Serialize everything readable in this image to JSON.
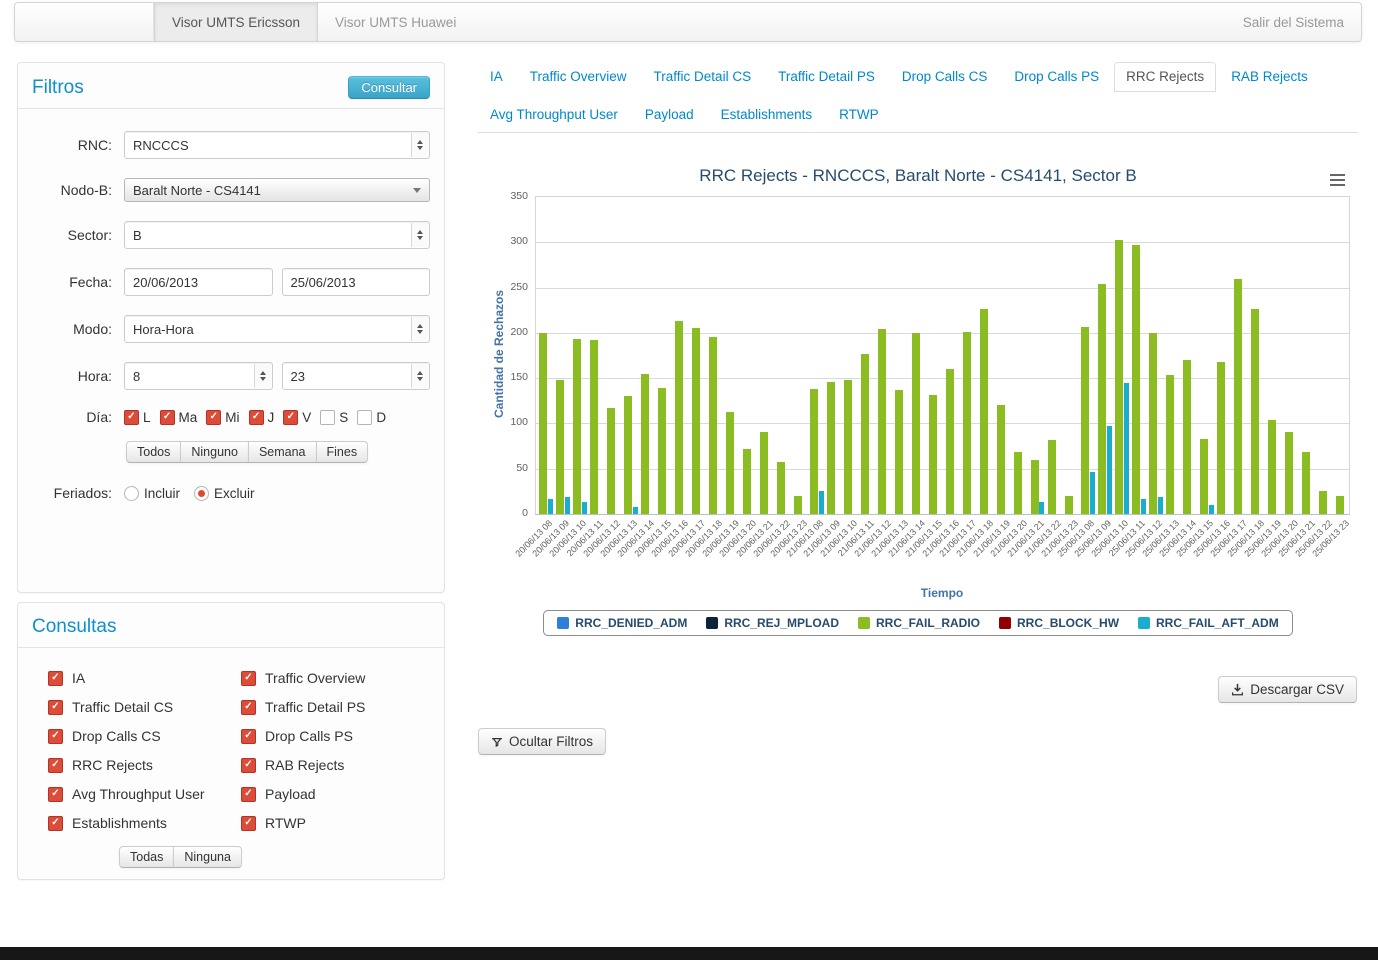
{
  "navbar": {
    "tab_ericsson": "Visor UMTS Ericsson",
    "tab_huawei": "Visor UMTS Huawei",
    "logout": "Salir del Sistema"
  },
  "filtros": {
    "title": "Filtros",
    "consultar_button": "Consultar",
    "fields": {
      "rnc": {
        "label": "RNC:",
        "value": "RNCCCS"
      },
      "nodob": {
        "label": "Nodo-B:",
        "value": "Baralt Norte - CS4141"
      },
      "sector": {
        "label": "Sector:",
        "value": "B"
      },
      "fecha": {
        "label": "Fecha:",
        "from": "20/06/2013",
        "to": "25/06/2013"
      },
      "modo": {
        "label": "Modo:",
        "value": "Hora-Hora"
      },
      "hora": {
        "label": "Hora:",
        "from": "8",
        "to": "23"
      },
      "dia": {
        "label": "Día:",
        "days": [
          {
            "label": "L",
            "checked": true
          },
          {
            "label": "Ma",
            "checked": true
          },
          {
            "label": "Mi",
            "checked": true
          },
          {
            "label": "J",
            "checked": true
          },
          {
            "label": "V",
            "checked": true
          },
          {
            "label": "S",
            "checked": false
          },
          {
            "label": "D",
            "checked": false
          }
        ]
      },
      "feriados": {
        "label": "Feriados:",
        "options": [
          {
            "label": "Incluir",
            "selected": false
          },
          {
            "label": "Excluir",
            "selected": true
          }
        ]
      }
    },
    "day_buttons": [
      "Todos",
      "Ninguno",
      "Semana",
      "Fines"
    ]
  },
  "consultas": {
    "title": "Consultas",
    "items": [
      {
        "label": "IA",
        "checked": true
      },
      {
        "label": "Traffic Overview",
        "checked": true
      },
      {
        "label": "Traffic Detail CS",
        "checked": true
      },
      {
        "label": "Traffic Detail PS",
        "checked": true
      },
      {
        "label": "Drop Calls CS",
        "checked": true
      },
      {
        "label": "Drop Calls PS",
        "checked": true
      },
      {
        "label": "RRC Rejects",
        "checked": true
      },
      {
        "label": "RAB Rejects",
        "checked": true
      },
      {
        "label": "Avg Throughput User",
        "checked": true
      },
      {
        "label": "Payload",
        "checked": true
      },
      {
        "label": "Establishments",
        "checked": true
      },
      {
        "label": "RTWP",
        "checked": true
      }
    ],
    "buttons": [
      "Todas",
      "Ninguna"
    ]
  },
  "tabs": {
    "items": [
      {
        "label": "IA",
        "active": false
      },
      {
        "label": "Traffic Overview",
        "active": false
      },
      {
        "label": "Traffic Detail CS",
        "active": false
      },
      {
        "label": "Traffic Detail PS",
        "active": false
      },
      {
        "label": "Drop Calls CS",
        "active": false
      },
      {
        "label": "Drop Calls PS",
        "active": false
      },
      {
        "label": "RRC Rejects",
        "active": true
      },
      {
        "label": "RAB Rejects",
        "active": false
      },
      {
        "label": "Avg Throughput User",
        "active": false
      },
      {
        "label": "Payload",
        "active": false
      },
      {
        "label": "Establishments",
        "active": false
      },
      {
        "label": "RTWP",
        "active": false
      }
    ]
  },
  "chart_data": {
    "type": "bar",
    "title": "RRC Rejects - RNCCCS, Baralt Norte - CS4141, Sector B",
    "xlabel": "Tiempo",
    "ylabel": "Cantidad de Rechazos",
    "ylim": [
      0,
      350
    ],
    "yticks": [
      0,
      50,
      100,
      150,
      200,
      250,
      300,
      350
    ],
    "grid": true,
    "legend_position": "bottom",
    "categories": [
      "20/06/13 08",
      "20/06/13 09",
      "20/06/13 10",
      "20/06/13 11",
      "20/06/13 12",
      "20/06/13 13",
      "20/06/13 14",
      "20/06/13 15",
      "20/06/13 16",
      "20/06/13 17",
      "20/06/13 18",
      "20/06/13 19",
      "20/06/13 20",
      "20/06/13 21",
      "20/06/13 22",
      "20/06/13 23",
      "21/06/13 08",
      "21/06/13 09",
      "21/06/13 10",
      "21/06/13 11",
      "21/06/13 12",
      "21/06/13 13",
      "21/06/13 14",
      "21/06/13 15",
      "21/06/13 16",
      "21/06/13 17",
      "21/06/13 18",
      "21/06/13 19",
      "21/06/13 20",
      "21/06/13 21",
      "21/06/13 22",
      "21/06/13 23",
      "25/06/13 08",
      "25/06/13 09",
      "25/06/13 10",
      "25/06/13 11",
      "25/06/13 12",
      "25/06/13 13",
      "25/06/13 14",
      "25/06/13 15",
      "25/06/13 16",
      "25/06/13 17",
      "25/06/13 18",
      "25/06/13 19",
      "25/06/13 20",
      "25/06/13 21",
      "25/06/13 22",
      "25/06/13 23"
    ],
    "series": [
      {
        "name": "RRC_DENIED_ADM",
        "color": "#2f7ed8",
        "values": []
      },
      {
        "name": "RRC_REJ_MPLOAD",
        "color": "#0d233a",
        "values": []
      },
      {
        "name": "RRC_FAIL_RADIO",
        "color": "#8bbc21",
        "values": [
          200,
          148,
          193,
          192,
          117,
          130,
          155,
          139,
          213,
          205,
          195,
          113,
          72,
          91,
          57,
          20,
          138,
          146,
          148,
          177,
          204,
          137,
          200,
          131,
          160,
          201,
          226,
          120,
          68,
          60,
          82,
          20,
          207,
          254,
          303,
          297,
          200,
          154,
          170,
          83,
          168,
          259,
          226,
          104,
          91,
          68,
          25,
          20
        ]
      },
      {
        "name": "RRC_BLOCK_HW",
        "color": "#910000",
        "values": []
      },
      {
        "name": "RRC_FAIL_AFT_ADM",
        "color": "#1aadce",
        "values": [
          17,
          19,
          13,
          0,
          0,
          8,
          0,
          0,
          0,
          0,
          0,
          0,
          0,
          0,
          0,
          0,
          25,
          0,
          0,
          0,
          0,
          0,
          0,
          0,
          0,
          0,
          0,
          0,
          0,
          13,
          0,
          0,
          46,
          97,
          145,
          17,
          19,
          0,
          0,
          10,
          0,
          0,
          0,
          0,
          0,
          0,
          0,
          0
        ]
      }
    ]
  },
  "actions": {
    "descargar_csv": "Descargar CSV",
    "ocultar_filtros": "Ocultar Filtros"
  }
}
